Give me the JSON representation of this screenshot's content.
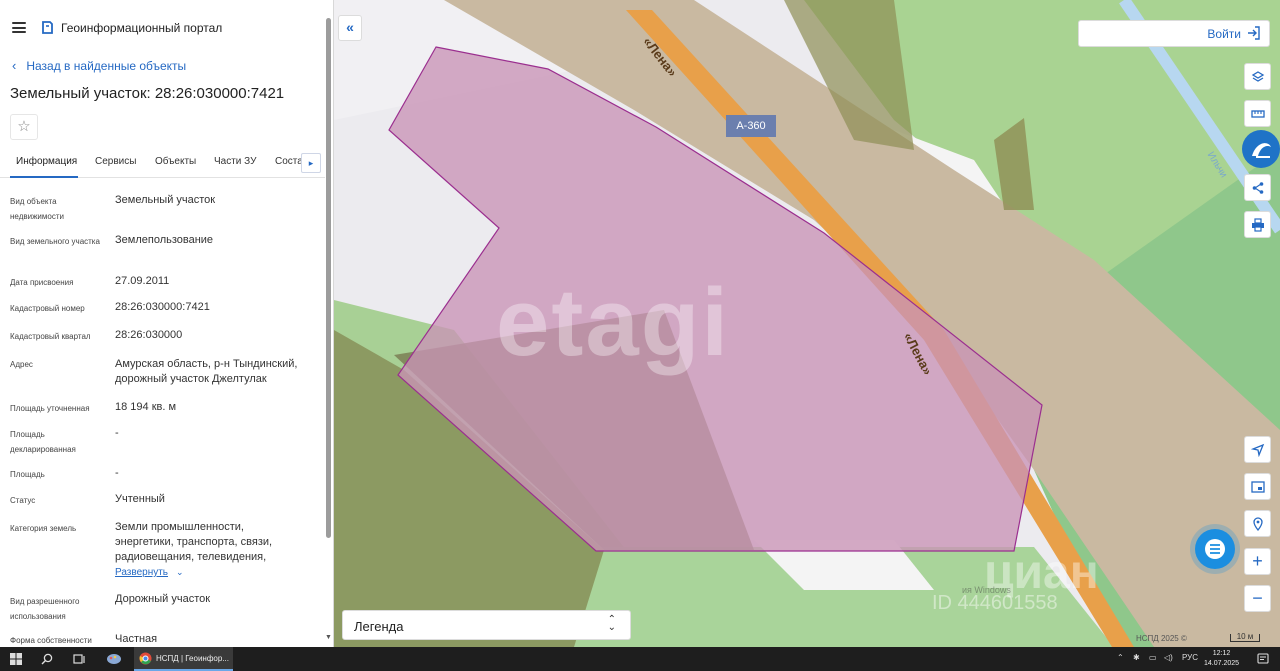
{
  "app": {
    "title": "Геоинформационный портал",
    "back_link": "Назад в найденные объекты",
    "object_title": "Земельный участок: 28:26:030000:7421"
  },
  "tabs": [
    {
      "label": "Информация",
      "active": true
    },
    {
      "label": "Сервисы",
      "active": false
    },
    {
      "label": "Объекты",
      "active": false
    },
    {
      "label": "Части ЗУ",
      "active": false
    },
    {
      "label": "Соста",
      "active": false
    }
  ],
  "properties": [
    {
      "label": "Вид объекта недвижимости",
      "value": "Земельный участок"
    },
    {
      "label": "Вид земельного участка",
      "value": "Землепользование"
    },
    {
      "label": "Дата присвоения",
      "value": "27.09.2011"
    },
    {
      "label": "Кадастровый номер",
      "value": "28:26:030000:7421"
    },
    {
      "label": "Кадастровый квартал",
      "value": "28:26:030000"
    },
    {
      "label": "Адрес",
      "value": "Амурская область, р-н Тындинский, дорожный участок Джелтулак"
    },
    {
      "label": "Площадь уточненная",
      "value": "18 194 кв. м"
    },
    {
      "label": "Площадь декларированная",
      "value": "-"
    },
    {
      "label": "Площадь",
      "value": "-"
    },
    {
      "label": "Статус",
      "value": "Учтенный"
    },
    {
      "label": "Категория земель",
      "value": "Земли промышленности, энергетики, транспорта, связи, радиовещания, телевидения,"
    },
    {
      "label": "Вид разрешенного использования",
      "value": "Дорожный участок"
    },
    {
      "label": "Форма собственности",
      "value": "Частная"
    }
  ],
  "expand_link": "Развернуть",
  "map": {
    "login_label": "Войти",
    "legend_label": "Легенда",
    "road_label": "«Лена»",
    "route_badge": "А-360",
    "river_label": "Ильчи",
    "watermark_etagi": "etagi",
    "watermark_cian": "циан",
    "watermark_id": "ID 444601558",
    "watermark_windows": "ия Windows",
    "attribution": "НСПД 2025 ©",
    "scale_label": "10 м",
    "colors": {
      "parcel_fill": "#c994b6",
      "parcel_stroke": "#9b2f8f",
      "road": "#e8a04a",
      "zone_beige": "#c9b9a1",
      "zone_green": "#8fc27a",
      "zone_olive": "#8f8f55",
      "accent": "#2569c3"
    }
  },
  "taskbar": {
    "app_label": "НСПД | Геоинфор...",
    "lang": "РУС",
    "time": "12:12",
    "date": "14.07.2025"
  }
}
